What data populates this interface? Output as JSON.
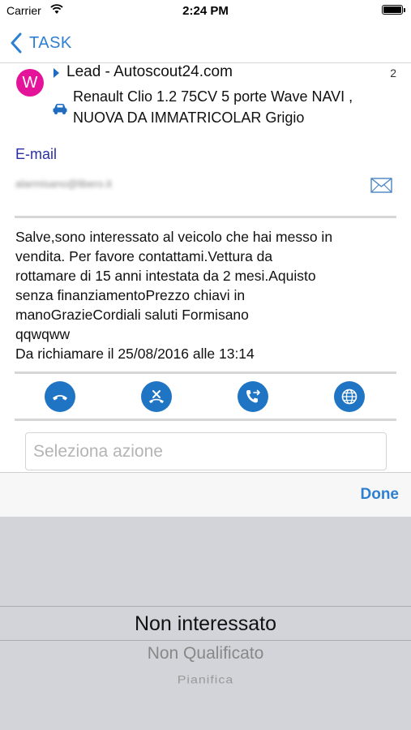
{
  "status_bar": {
    "carrier": "Carrier",
    "time": "2:24 PM"
  },
  "nav": {
    "back_label": "TASK"
  },
  "lead": {
    "avatar_letter": "W",
    "title": "Lead - Autoscout24.com",
    "count": "2",
    "vehicle_line1": "Renault Clio 1.2 75CV 5 porte Wave NAVI ,",
    "vehicle_line2": "NUOVA DA IMMATRICOLAR Grigio"
  },
  "email": {
    "label": "E-mail",
    "value": "alarmisano@libero.it"
  },
  "message": {
    "lines": [
      "Salve,sono interessato al veicolo che hai messo in",
      "vendita. Per favore contattami.Vettura da",
      "rottamare di 15 anni intestata da 2 mesi.Aquisto",
      "senza finanziamentoPrezzo chiavi in",
      "manoGrazieCordiali saluti Formisano",
      "qqwqww",
      "Da richiamare il 25/08/2016 alle 13:14"
    ]
  },
  "actions": {
    "colors": {
      "button": "#1f75c4",
      "link": "#2f7fd1",
      "avatar": "#e5139a"
    },
    "icons": [
      "phone-icon",
      "phone-cancel-icon",
      "call-transfer-icon",
      "globe-icon"
    ]
  },
  "select_action": {
    "placeholder": "Seleziona azione"
  },
  "picker": {
    "done_label": "Done",
    "options": [
      "Non interessato",
      "Non Qualificato",
      "Pianifica"
    ],
    "selected": "Non interessato"
  }
}
